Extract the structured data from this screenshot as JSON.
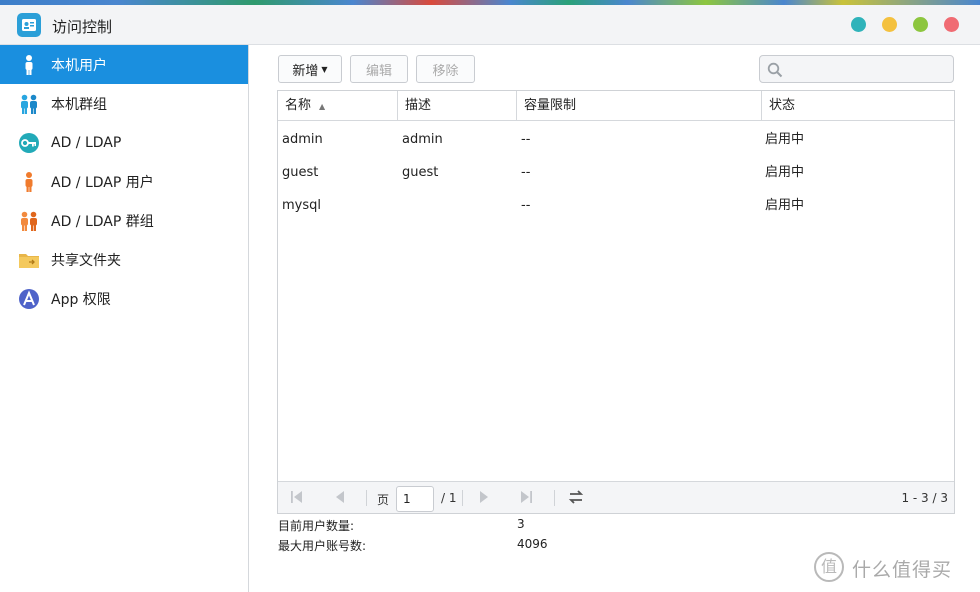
{
  "window": {
    "title": "访问控制",
    "controls": [
      "minimize",
      "maximize",
      "help",
      "close"
    ]
  },
  "sidebar": {
    "items": [
      {
        "label": "本机用户",
        "icon": "user-icon",
        "active": true
      },
      {
        "label": "本机群组",
        "icon": "group-icon",
        "active": false
      },
      {
        "label": "AD / LDAP",
        "icon": "key-icon",
        "active": false
      },
      {
        "label": "AD / LDAP 用户",
        "icon": "user-icon",
        "active": false
      },
      {
        "label": "AD / LDAP 群组",
        "icon": "group-icon",
        "active": false
      },
      {
        "label": "共享文件夹",
        "icon": "folder-icon",
        "active": false
      },
      {
        "label": "App 权限",
        "icon": "app-icon",
        "active": false
      }
    ]
  },
  "toolbar": {
    "new_label": "新增",
    "edit_label": "编辑",
    "remove_label": "移除",
    "search_placeholder": ""
  },
  "table": {
    "columns": [
      "名称",
      "描述",
      "容量限制",
      "状态"
    ],
    "rows": [
      {
        "name": "admin",
        "desc": "admin",
        "quota": "--",
        "status": "启用中"
      },
      {
        "name": "guest",
        "desc": "guest",
        "quota": "--",
        "status": "启用中"
      },
      {
        "name": "mysql",
        "desc": "",
        "quota": "--",
        "status": "启用中"
      }
    ]
  },
  "pager": {
    "page_label": "页",
    "current_page": "1",
    "total_pages": "/ 1",
    "range": "1 - 3 / 3"
  },
  "stats": {
    "current_users_label": "目前用户数量:",
    "current_users_value": "3",
    "max_users_label": "最大用户账号数:",
    "max_users_value": "4096"
  },
  "watermark": {
    "text": "什么值得买",
    "symbol": "值"
  },
  "colors": {
    "accent": "#1a8fdf",
    "window_btn_1": "#2fb3ba",
    "window_btn_2": "#f4c13f",
    "window_btn_3": "#8dc63f",
    "window_btn_4": "#f06b73"
  }
}
